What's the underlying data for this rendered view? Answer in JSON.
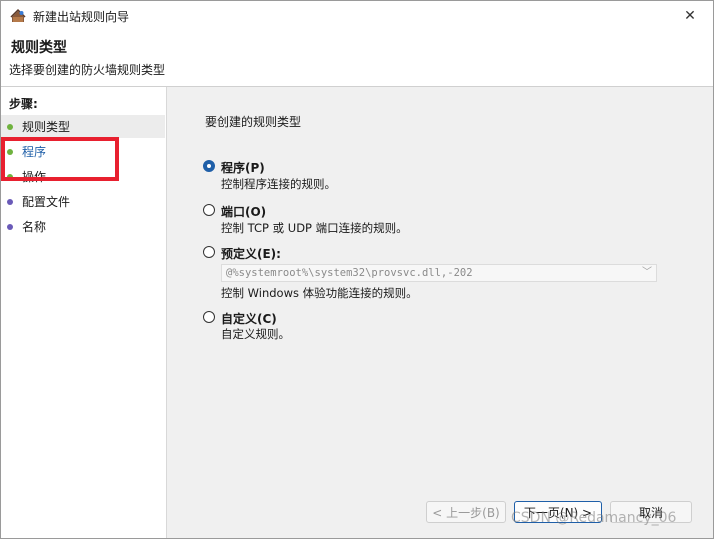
{
  "window": {
    "title": "新建出站规则向导",
    "close_glyph": "✕"
  },
  "header": {
    "title": "规则类型",
    "subtitle": "选择要创建的防火墙规则类型"
  },
  "sidebar": {
    "steps_label": "步骤:",
    "items": [
      {
        "label": "规则类型",
        "dot": "green"
      },
      {
        "label": "程序",
        "dot": "green"
      },
      {
        "label": "操作",
        "dot": "green"
      },
      {
        "label": "配置文件",
        "dot": "purple"
      },
      {
        "label": "名称",
        "dot": "purple"
      }
    ]
  },
  "content": {
    "heading": "要创建的规则类型",
    "options": [
      {
        "title": "程序(P)",
        "desc": "控制程序连接的规则。",
        "checked": true
      },
      {
        "title": "端口(O)",
        "desc": "控制 TCP 或 UDP 端口连接的规则。",
        "checked": false
      },
      {
        "title": "预定义(E):",
        "desc": "控制 Windows 体验功能连接的规则。",
        "checked": false
      },
      {
        "title": "自定义(C)",
        "desc": "自定义规则。",
        "checked": false
      }
    ],
    "predefined_select": {
      "value": "@%systemroot%\\system32\\provsvc.dll,-202",
      "enabled": false
    }
  },
  "buttons": {
    "back": "< 上一步(B)",
    "next": "下一页(N) >",
    "cancel": "取消"
  },
  "watermark": "CSDN @Redamancy_06",
  "colors": {
    "accent": "#1f5fa8",
    "highlight_box": "#e8202f",
    "dot_green": "#6fb23e",
    "dot_purple": "#6a5ab8"
  }
}
